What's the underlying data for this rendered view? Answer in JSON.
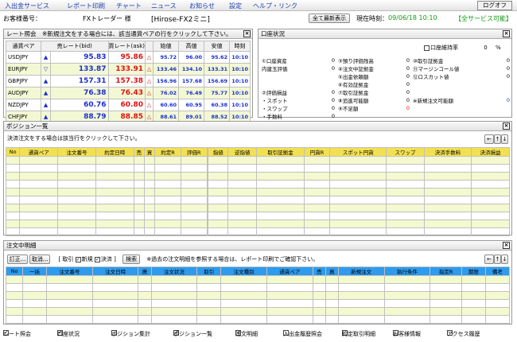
{
  "menu": [
    "入出金サービス",
    "レポート印刷",
    "チャート",
    "ニュース",
    "お知らせ",
    "設定",
    "ヘルプ・リンク"
  ],
  "logoff": "ログオフ",
  "info": {
    "customer_label": "お客様番号：",
    "customer_name": "FXトレーダー 様",
    "account_type": "[Hirose-FX2ミニ]",
    "refresh_button": "全て最新表示",
    "time_label": "現在時刻：",
    "time_value": "09/06/18 10:10",
    "service_status": "【全サービス可能】"
  },
  "rate_panel": {
    "title": "レート照会　※新規注文をする場合には、該当通貨ペアの行をクリックして下さい。",
    "headers": [
      "通貨ペア",
      "売レート(bid)",
      "買レート(ask)",
      "",
      "始値",
      "高値",
      "安値",
      "時刻"
    ],
    "rows": [
      {
        "pair": "USDJPY",
        "dir": "▲",
        "bid": "95.83",
        "ask": "95.86",
        "tri": "△",
        "open": "95.72",
        "high": "96.00",
        "low": "95.62",
        "time": "10:10"
      },
      {
        "pair": "EURJPY",
        "dir": "▽",
        "bid": "133.87",
        "ask": "133.91",
        "tri": "△",
        "open": "133.46",
        "high": "134.10",
        "low": "133.31",
        "time": "10:10"
      },
      {
        "pair": "GBPJPY",
        "dir": "▲",
        "bid": "157.31",
        "ask": "157.38",
        "tri": "△",
        "open": "156.96",
        "high": "157.68",
        "low": "156.69",
        "time": "10:10"
      },
      {
        "pair": "AUDJPY",
        "dir": "▲",
        "bid": "76.38",
        "ask": "76.43",
        "tri": "△",
        "open": "76.02",
        "high": "76.49",
        "low": "75.77",
        "time": "10:10"
      },
      {
        "pair": "NZDJPY",
        "dir": "▲",
        "bid": "60.76",
        "ask": "60.80",
        "tri": "△",
        "open": "60.60",
        "high": "60.95",
        "low": "60.38",
        "time": "10:10"
      },
      {
        "pair": "CHFJPY",
        "dir": "▲",
        "bid": "88.79",
        "ask": "88.85",
        "tri": "△",
        "open": "88.61",
        "high": "89.01",
        "low": "88.52",
        "time": "10:10"
      }
    ]
  },
  "account_panel": {
    "title": "口座状況",
    "maintenance_label": "口座維持率",
    "maintenance_value": "0",
    "maintenance_unit": "%",
    "col1": [
      [
        "①口座資産",
        "0"
      ],
      [
        "内建玉評価",
        "0"
      ],
      [
        "",
        ""
      ],
      [
        "",
        ""
      ],
      [
        "②評価損益",
        "0"
      ],
      [
        "・スポット",
        "0"
      ],
      [
        "・スワップ",
        "0"
      ],
      [
        "・手数料",
        "0"
      ]
    ],
    "col2": [
      [
        "③預り評価残高",
        "0"
      ],
      [
        "④注文中証拠金",
        "0"
      ],
      [
        "⑤出金依頼額",
        "0"
      ],
      [
        "⑥有効証拠金",
        "0"
      ],
      [
        "⑦取引証拠金",
        "0"
      ],
      [
        "⑧追進可能額",
        "0"
      ],
      [
        "⑨不足額",
        "0"
      ]
    ],
    "col3": [
      [
        "⑩取引証拠金",
        "0"
      ],
      [
        "⑪マージンコール値",
        "0"
      ],
      [
        "⑫ロスカット値",
        "0"
      ],
      [
        "",
        ""
      ],
      [
        "",
        ""
      ],
      [
        "※新規注文可能額",
        "0"
      ]
    ]
  },
  "position_panel": {
    "title": "ポジション一覧",
    "note": "決済注文をする場合は該当行をクリックして下さい。",
    "headers": [
      "No",
      "通貨ペア",
      "注文番号",
      "約定日時",
      "売",
      "買",
      "約定R",
      "評価R",
      "",
      "指値",
      "逆指値",
      "取引証拠金",
      "円貨R",
      "スポット円貨",
      "スワップ",
      "決済手数料",
      "決済損益"
    ]
  },
  "order_panel": {
    "title": "注文中明細",
    "btn_correct": "訂正...",
    "btn_cancel": "取消...",
    "filter_open": "[ 取引",
    "filter_new": "新規",
    "filter_close": "決済 ]",
    "btn_search": "検索",
    "note": "※過去の注文明細を参照する場合は、レポート印刷でご確認下さい。",
    "headers": [
      "No",
      "一括",
      "注文番号",
      "注文日時",
      "携",
      "注文状況",
      "取引",
      "注文種別",
      "通貨ペア",
      "売",
      "買",
      "新規注文",
      "執行条件",
      "指定R",
      "期限",
      "備考"
    ]
  },
  "bottom": [
    "レート照会",
    "口座状況",
    "ポジション集計",
    "ポジション一覧",
    "注文明細",
    "入出金履歴照会",
    "約定取引明細",
    "お客様情報",
    "アクセス履歴"
  ],
  "bottom_checked": [
    true,
    true,
    false,
    true,
    true,
    false,
    false,
    false,
    false
  ]
}
